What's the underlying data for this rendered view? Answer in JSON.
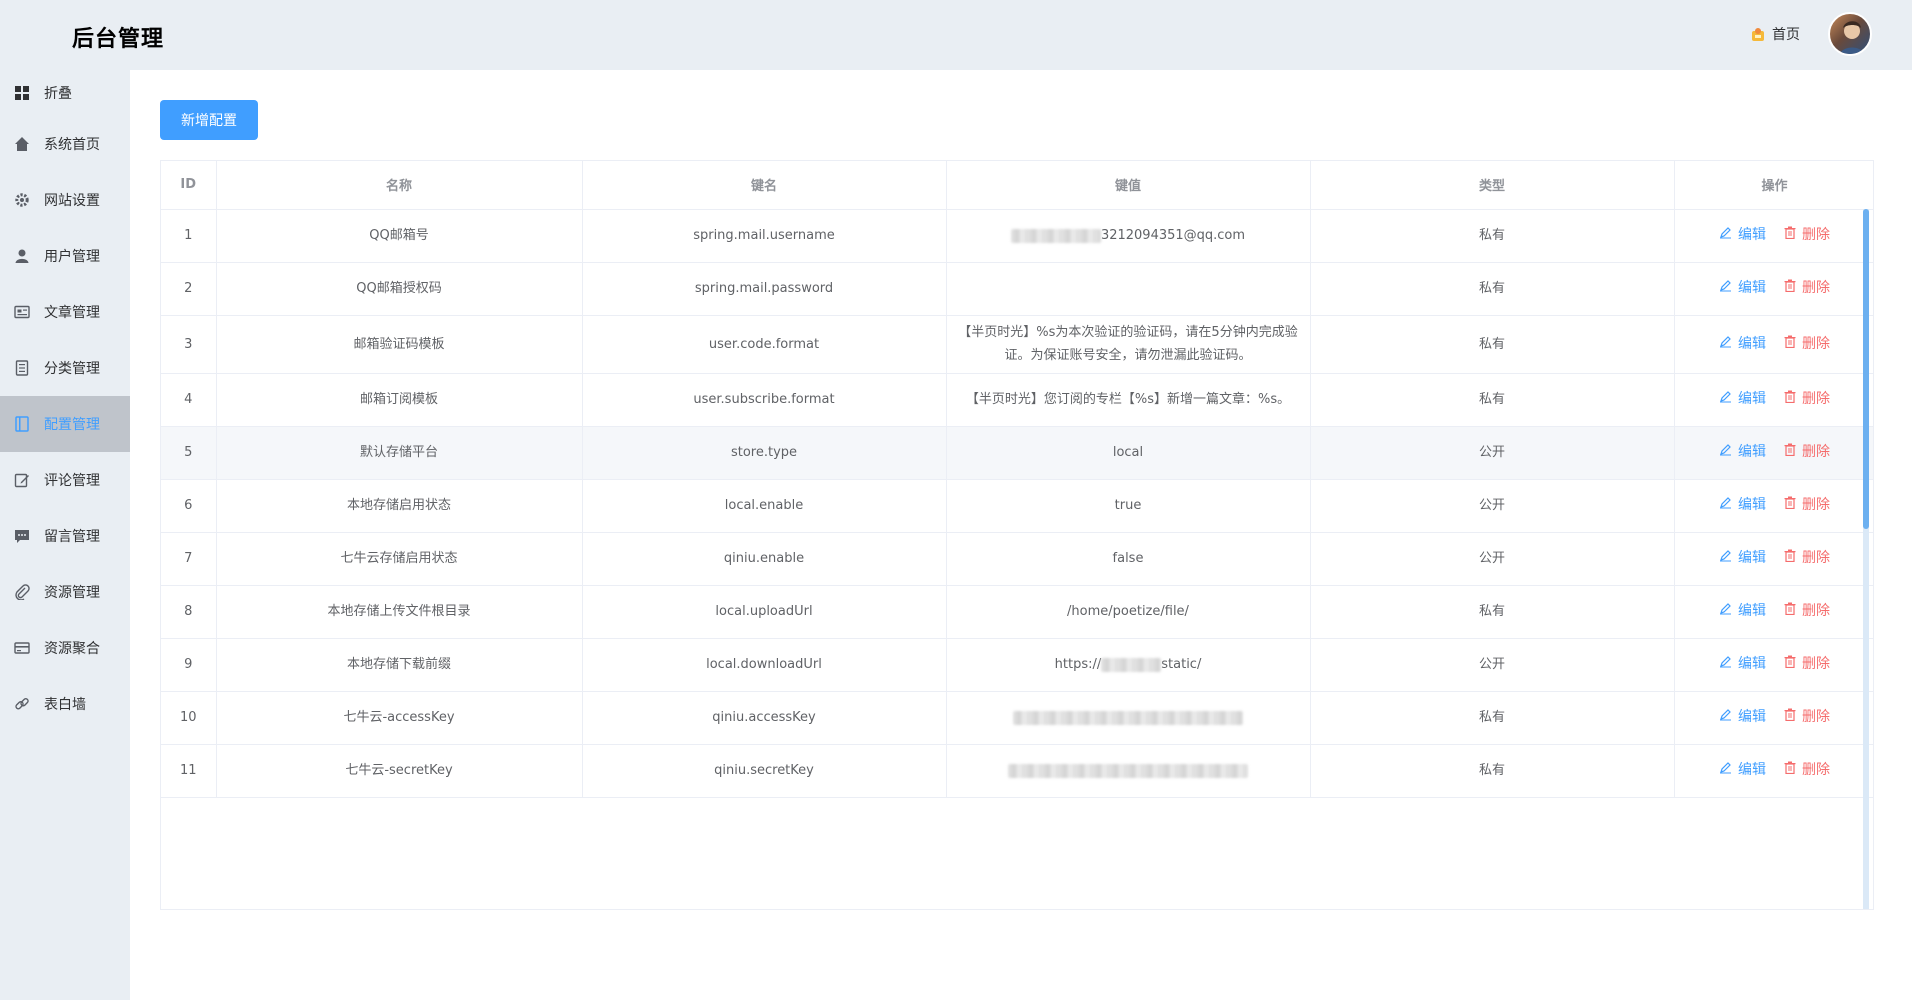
{
  "app": {
    "title": "后台管理"
  },
  "header": {
    "home_label": "首页"
  },
  "sidebar": {
    "items": [
      {
        "label": "折叠",
        "icon": "grid-icon"
      },
      {
        "label": "系统首页",
        "icon": "home-icon"
      },
      {
        "label": "网站设置",
        "icon": "gear-icon"
      },
      {
        "label": "用户管理",
        "icon": "user-icon"
      },
      {
        "label": "文章管理",
        "icon": "article-icon"
      },
      {
        "label": "分类管理",
        "icon": "category-icon"
      },
      {
        "label": "配置管理",
        "icon": "config-icon",
        "active": true
      },
      {
        "label": "评论管理",
        "icon": "comment-edit-icon"
      },
      {
        "label": "留言管理",
        "icon": "message-icon"
      },
      {
        "label": "资源管理",
        "icon": "paperclip-icon"
      },
      {
        "label": "资源聚合",
        "icon": "card-icon"
      },
      {
        "label": "表白墙",
        "icon": "link-icon"
      }
    ]
  },
  "toolbar": {
    "add_label": "新增配置"
  },
  "table": {
    "headers": [
      "ID",
      "名称",
      "键名",
      "键值",
      "类型",
      "操作"
    ],
    "edit_label": "编辑",
    "delete_label": "删除",
    "rows": [
      {
        "id": "1",
        "name": "QQ邮箱号",
        "key": "spring.mail.username",
        "value": "3212094351@qq.com",
        "type": "私有"
      },
      {
        "id": "2",
        "name": "QQ邮箱授权码",
        "key": "spring.mail.password",
        "value": "",
        "type": "私有"
      },
      {
        "id": "3",
        "name": "邮箱验证码模板",
        "key": "user.code.format",
        "value": "【半页时光】%s为本次验证的验证码，请在5分钟内完成验证。为保证账号安全，请勿泄漏此验证码。",
        "type": "私有"
      },
      {
        "id": "4",
        "name": "邮箱订阅模板",
        "key": "user.subscribe.format",
        "value": "【半页时光】您订阅的专栏【%s】新增一篇文章：%s。",
        "type": "私有"
      },
      {
        "id": "5",
        "name": "默认存储平台",
        "key": "store.type",
        "value": "local",
        "type": "公开"
      },
      {
        "id": "6",
        "name": "本地存储启用状态",
        "key": "local.enable",
        "value": "true",
        "type": "公开"
      },
      {
        "id": "7",
        "name": "七牛云存储启用状态",
        "key": "qiniu.enable",
        "value": "false",
        "type": "公开"
      },
      {
        "id": "8",
        "name": "本地存储上传文件根目录",
        "key": "local.uploadUrl",
        "value": "/home/poetize/file/",
        "type": "私有"
      },
      {
        "id": "9",
        "name": "本地存储下载前缀",
        "key": "local.downloadUrl",
        "value": "https://",
        "value_suffix": "static/",
        "type": "公开"
      },
      {
        "id": "10",
        "name": "七牛云-accessKey",
        "key": "qiniu.accessKey",
        "value": "",
        "type": "私有"
      },
      {
        "id": "11",
        "name": "七牛云-secretKey",
        "key": "qiniu.secretKey",
        "value": "",
        "type": "私有"
      }
    ]
  },
  "colors": {
    "accent": "#409eff",
    "danger": "#f56c6c",
    "sidebar_bg": "#e9eef3",
    "active_bg": "#bfc4cb"
  }
}
